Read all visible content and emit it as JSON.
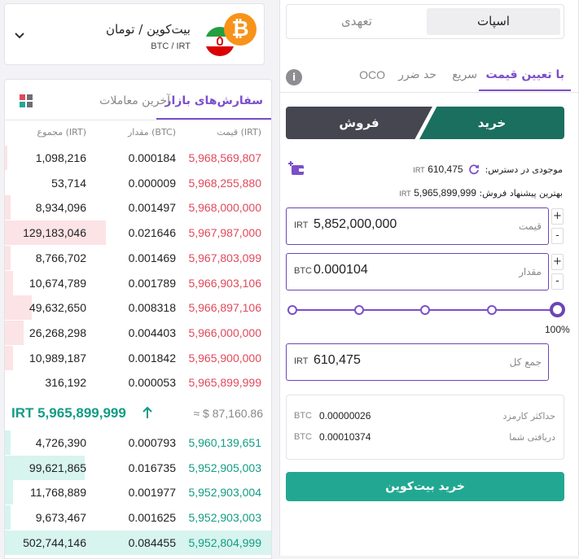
{
  "pair": {
    "title": "بیت‌کوین / تومان",
    "symbol": "BTC / IRT"
  },
  "book": {
    "tab_active": "سفارش‌های بازار",
    "tab_inactive": "آخرین معاملات",
    "col_price": "قیمت (IRT)",
    "col_amount": "مقدار (BTC)",
    "col_total": "مجموع (IRT)",
    "asks": [
      {
        "price": "5,968,569,807",
        "amount": "0.000184",
        "total": "1,098,216",
        "depth": 0.01
      },
      {
        "price": "5,968,255,880",
        "amount": "0.000009",
        "total": "53,714",
        "depth": 0.0
      },
      {
        "price": "5,968,000,000",
        "amount": "0.001497",
        "total": "8,934,096",
        "depth": 0.02
      },
      {
        "price": "5,967,987,000",
        "amount": "0.021646",
        "total": "129,183,046",
        "depth": 0.38
      },
      {
        "price": "5,967,803,099",
        "amount": "0.001469",
        "total": "8,766,702",
        "depth": 0.02
      },
      {
        "price": "5,966,903,106",
        "amount": "0.001789",
        "total": "10,674,789",
        "depth": 0.03
      },
      {
        "price": "5,966,897,106",
        "amount": "0.008318",
        "total": "49,632,650",
        "depth": 0.1
      },
      {
        "price": "5,966,000,000",
        "amount": "0.004403",
        "total": "26,268,298",
        "depth": 0.07
      },
      {
        "price": "5,965,900,000",
        "amount": "0.001842",
        "total": "10,989,187",
        "depth": 0.03
      },
      {
        "price": "5,965,899,999",
        "amount": "0.000053",
        "total": "316,192",
        "depth": 0.0
      }
    ],
    "mid_price": "IRT 5,965,899,999",
    "mid_usd": "≈ $ 87,160.86",
    "bids": [
      {
        "price": "5,960,139,651",
        "amount": "0.000793",
        "total": "4,726,390",
        "depth": 0.02
      },
      {
        "price": "5,952,905,003",
        "amount": "0.016735",
        "total": "99,621,865",
        "depth": 0.3
      },
      {
        "price": "5,952,903,004",
        "amount": "0.001977",
        "total": "11,768,889",
        "depth": 0.03
      },
      {
        "price": "5,952,903,003",
        "amount": "0.001625",
        "total": "9,673,467",
        "depth": 0.02
      },
      {
        "price": "5,952,804,999",
        "amount": "0.084455",
        "total": "502,744,146",
        "depth": 1.0
      }
    ]
  },
  "market": {
    "spot": "اسپات",
    "margin": "تعهدی"
  },
  "order_tabs": {
    "limit": "با تعیین قیمت",
    "fast": "سریع",
    "stop": "حد ضرر",
    "oco": "OCO"
  },
  "side": {
    "buy": "خرید",
    "sell": "فروش"
  },
  "balance": {
    "label": "موجودی در دسترس:",
    "value": "610,475",
    "unit": "IRT"
  },
  "best_offer": {
    "label": "بهترین پیشنهاد فروش:",
    "value": "5,965,899,999",
    "unit": "IRT"
  },
  "price_field": {
    "label": "قیمت",
    "unit": "IRT",
    "value": "5,852,000,000"
  },
  "amount_field": {
    "label": "مقدار",
    "unit": "BTC",
    "value": "0.000104"
  },
  "slider": {
    "percent": "100%",
    "value": 1.0
  },
  "total_field": {
    "label": "جمع کل",
    "unit": "IRT",
    "value": "610,475"
  },
  "summary": {
    "max_fee_label": "حداکثر کارمزد",
    "max_fee_value": "0.00000026",
    "max_fee_unit": "BTC",
    "receive_label": "دریافتی شما",
    "receive_value": "0.00010374",
    "receive_unit": "BTC"
  },
  "submit_label": "خرید بیت‌کوین",
  "colors": {
    "accent": "#7b4fc9",
    "buy": "#22a892",
    "ask": "#e0495a",
    "bid": "#129c84"
  }
}
